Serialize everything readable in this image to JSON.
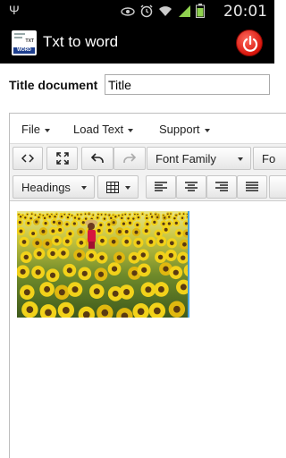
{
  "status_bar": {
    "time": "20:01",
    "icons": [
      "usb-icon",
      "eye-icon",
      "alarm-icon",
      "wifi-icon",
      "signal-icon",
      "battery-icon"
    ]
  },
  "app": {
    "title": "Txt to word",
    "icon_text_top": "TXT",
    "icon_text_bottom": "WORD"
  },
  "form": {
    "title_label": "Title document",
    "title_value": "Title"
  },
  "menubar": {
    "items": [
      {
        "label": "File"
      },
      {
        "label": "Load Text"
      },
      {
        "label": "Support"
      }
    ]
  },
  "toolbar": {
    "font_family_label": "Font Family",
    "font_size_label": "Fo",
    "headings_label": "Headings"
  },
  "content": {
    "image_subject": "sunflower field"
  },
  "colors": {
    "status_bg": "#000000",
    "accent_power": "#e2211c",
    "selection_border": "#4aa3df"
  }
}
